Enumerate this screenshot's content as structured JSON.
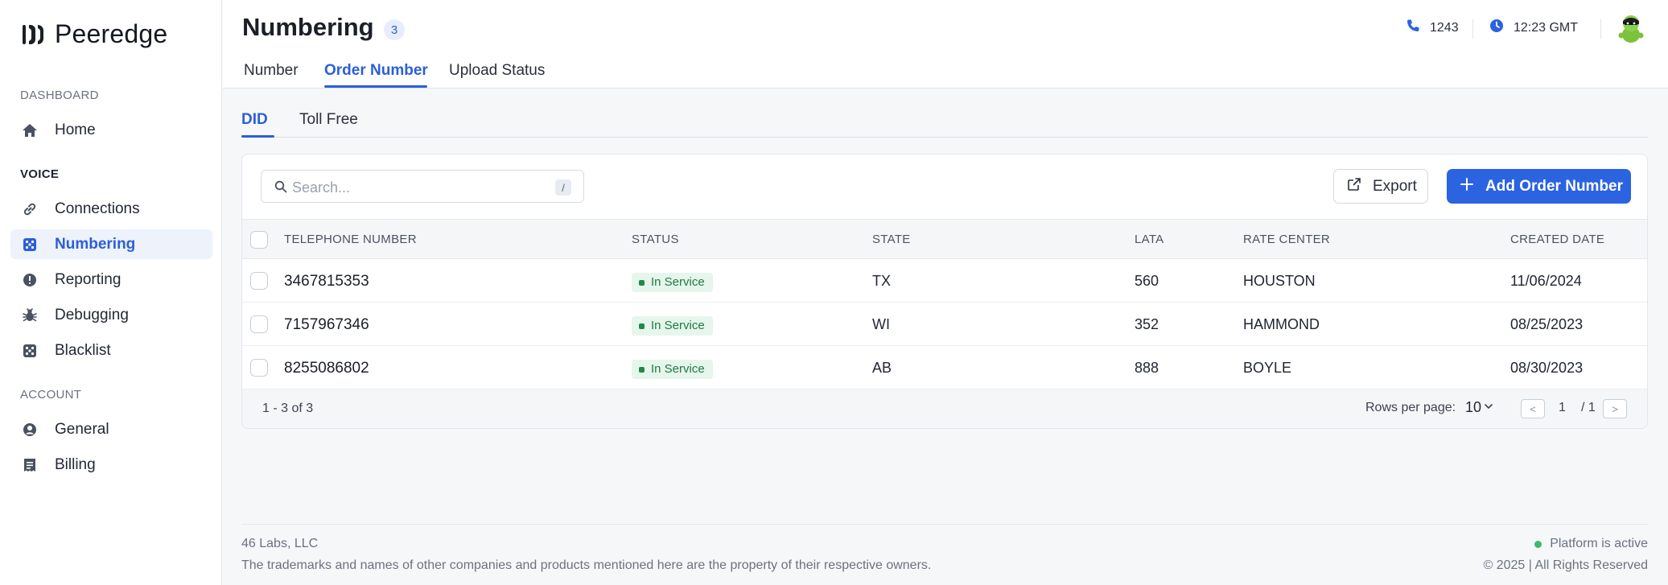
{
  "brand": {
    "name": "Peeredge"
  },
  "sidebar": {
    "sections": [
      {
        "label": "DASHBOARD"
      },
      {
        "label": "VOICE"
      },
      {
        "label": "ACCOUNT"
      }
    ],
    "items": [
      {
        "label": "Home",
        "icon": "home-icon"
      },
      {
        "label": "Connections",
        "icon": "link-icon"
      },
      {
        "label": "Numbering",
        "icon": "dice-icon",
        "active": true
      },
      {
        "label": "Reporting",
        "icon": "alert-circle-icon"
      },
      {
        "label": "Debugging",
        "icon": "bug-icon"
      },
      {
        "label": "Blacklist",
        "icon": "dice-icon"
      },
      {
        "label": "General",
        "icon": "user-circle-icon"
      },
      {
        "label": "Billing",
        "icon": "receipt-icon"
      }
    ]
  },
  "header": {
    "title": "Numbering",
    "count": "3",
    "tabs": [
      {
        "label": "Number"
      },
      {
        "label": "Order Number",
        "active": true
      },
      {
        "label": "Upload Status"
      }
    ],
    "phone": "1243",
    "time": "12:23 GMT"
  },
  "sub_tabs": [
    {
      "label": "DID",
      "active": true
    },
    {
      "label": "Toll Free"
    }
  ],
  "toolbar": {
    "search_placeholder": "Search...",
    "search_shortcut": "/",
    "export_label": "Export",
    "add_label": "Add Order Number"
  },
  "table": {
    "columns": [
      "TELEPHONE NUMBER",
      "STATUS",
      "STATE",
      "LATA",
      "RATE CENTER",
      "CREATED DATE"
    ],
    "rows": [
      {
        "number": "3467815353",
        "status": "In Service",
        "state": "TX",
        "lata": "560",
        "rate_center": "HOUSTON",
        "created": "11/06/2024"
      },
      {
        "number": "7157967346",
        "status": "In Service",
        "state": "WI",
        "lata": "352",
        "rate_center": "HAMMOND",
        "created": "08/25/2023"
      },
      {
        "number": "8255086802",
        "status": "In Service",
        "state": "AB",
        "lata": "888",
        "rate_center": "BOYLE",
        "created": "08/30/2023"
      }
    ]
  },
  "pagination": {
    "range": "1 - 3 of 3",
    "rows_per_page_label": "Rows per page:",
    "rows_per_page": "10",
    "prev": "<",
    "page": "1",
    "total": "/ 1",
    "next": ">"
  },
  "footer": {
    "company": "46 Labs, LLC",
    "legal": "The trademarks and names of other companies and products mentioned here are the property of their respective owners.",
    "status": "Platform is active",
    "copyright": "© 2025 | All Rights Reserved"
  },
  "colors": {
    "accent": "#2b63e0",
    "status_green": "#1f8a4c",
    "active_dot": "#3fb872"
  }
}
